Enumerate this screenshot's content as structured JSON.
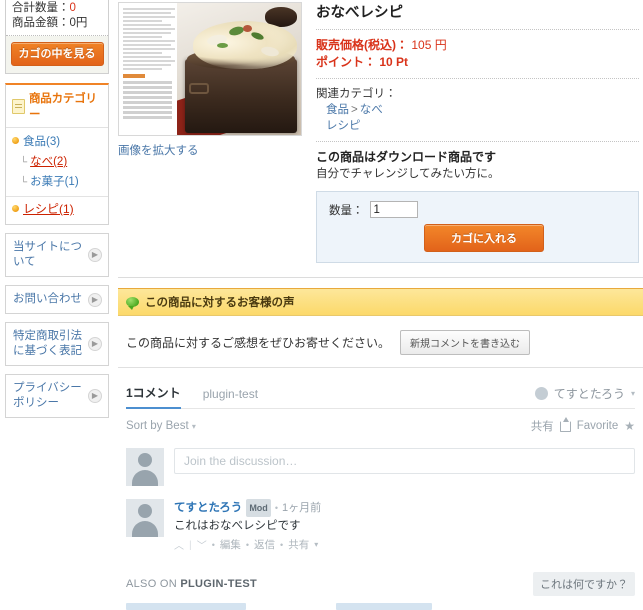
{
  "sidebar": {
    "cart": {
      "total_qty_label": "合計数量：",
      "total_qty_value": "0",
      "amount_label": "商品金額：",
      "amount_value": "0円",
      "view_cart_button": "カゴの中を見る"
    },
    "category_panel": {
      "title": "商品カテゴリー",
      "icon": "document-icon",
      "items": [
        {
          "label": "食品(3)",
          "level": 0,
          "state": "link"
        },
        {
          "label": "なべ(2)",
          "level": 1,
          "state": "active"
        },
        {
          "label": "お菓子(1)",
          "level": 1,
          "state": "link"
        },
        {
          "label": "レシピ(1)",
          "level": 0,
          "state": "active"
        }
      ]
    },
    "nav_items": [
      {
        "label": "当サイトについて"
      },
      {
        "label": "お問い合わせ"
      },
      {
        "label": "特定商取引法に基づく表記"
      },
      {
        "label": "プライバシーポリシー"
      }
    ]
  },
  "product": {
    "title": "おなべレシピ",
    "image_alt": "おなべレシピ 商品画像",
    "zoom_link": "画像を拡大する",
    "price_label": "販売価格(税込)：",
    "price_value": "105 円",
    "point_label": "ポイント：",
    "point_value": "10 Pt",
    "related_label": "関連カテゴリ：",
    "related": [
      {
        "parts": [
          "食品",
          "なべ"
        ]
      },
      {
        "parts": [
          "レシピ"
        ]
      }
    ],
    "download_notice": "この商品はダウンロード商品です",
    "description": "自分でチャレンジしてみたい方に。",
    "quantity_label": "数量：",
    "quantity_value": "1",
    "add_to_cart_button": "カゴに入れる"
  },
  "review": {
    "header": "この商品に対するお客様の声",
    "prompt": "この商品に対するご感想をぜひお寄せください。",
    "new_comment_button": "新規コメントを書き込む"
  },
  "disqus": {
    "comment_count_tab": "1コメント",
    "site_tab": "plugin-test",
    "current_user": "てすとたろう",
    "sort_label": "Sort by Best",
    "share_label": "共有",
    "favorite_label": "Favorite",
    "compose_placeholder": "Join the discussion…",
    "comments": [
      {
        "author": "てすとたろう",
        "badge": "Mod",
        "time": "1ヶ月前",
        "text": "これはおなべレシピです",
        "actions": [
          "編集",
          "返信",
          "共有"
        ]
      }
    ],
    "also_on_prefix": "ALSO ON",
    "also_on_site": "PLUGIN-TEST",
    "what_is_this": "これは何ですか？"
  },
  "colors": {
    "orange": "#e8740c",
    "price_red": "#d9331a",
    "link_blue": "#4a77a8",
    "review_yellow": "#fcd96a",
    "disqus_blue": "#4c8fd0"
  }
}
